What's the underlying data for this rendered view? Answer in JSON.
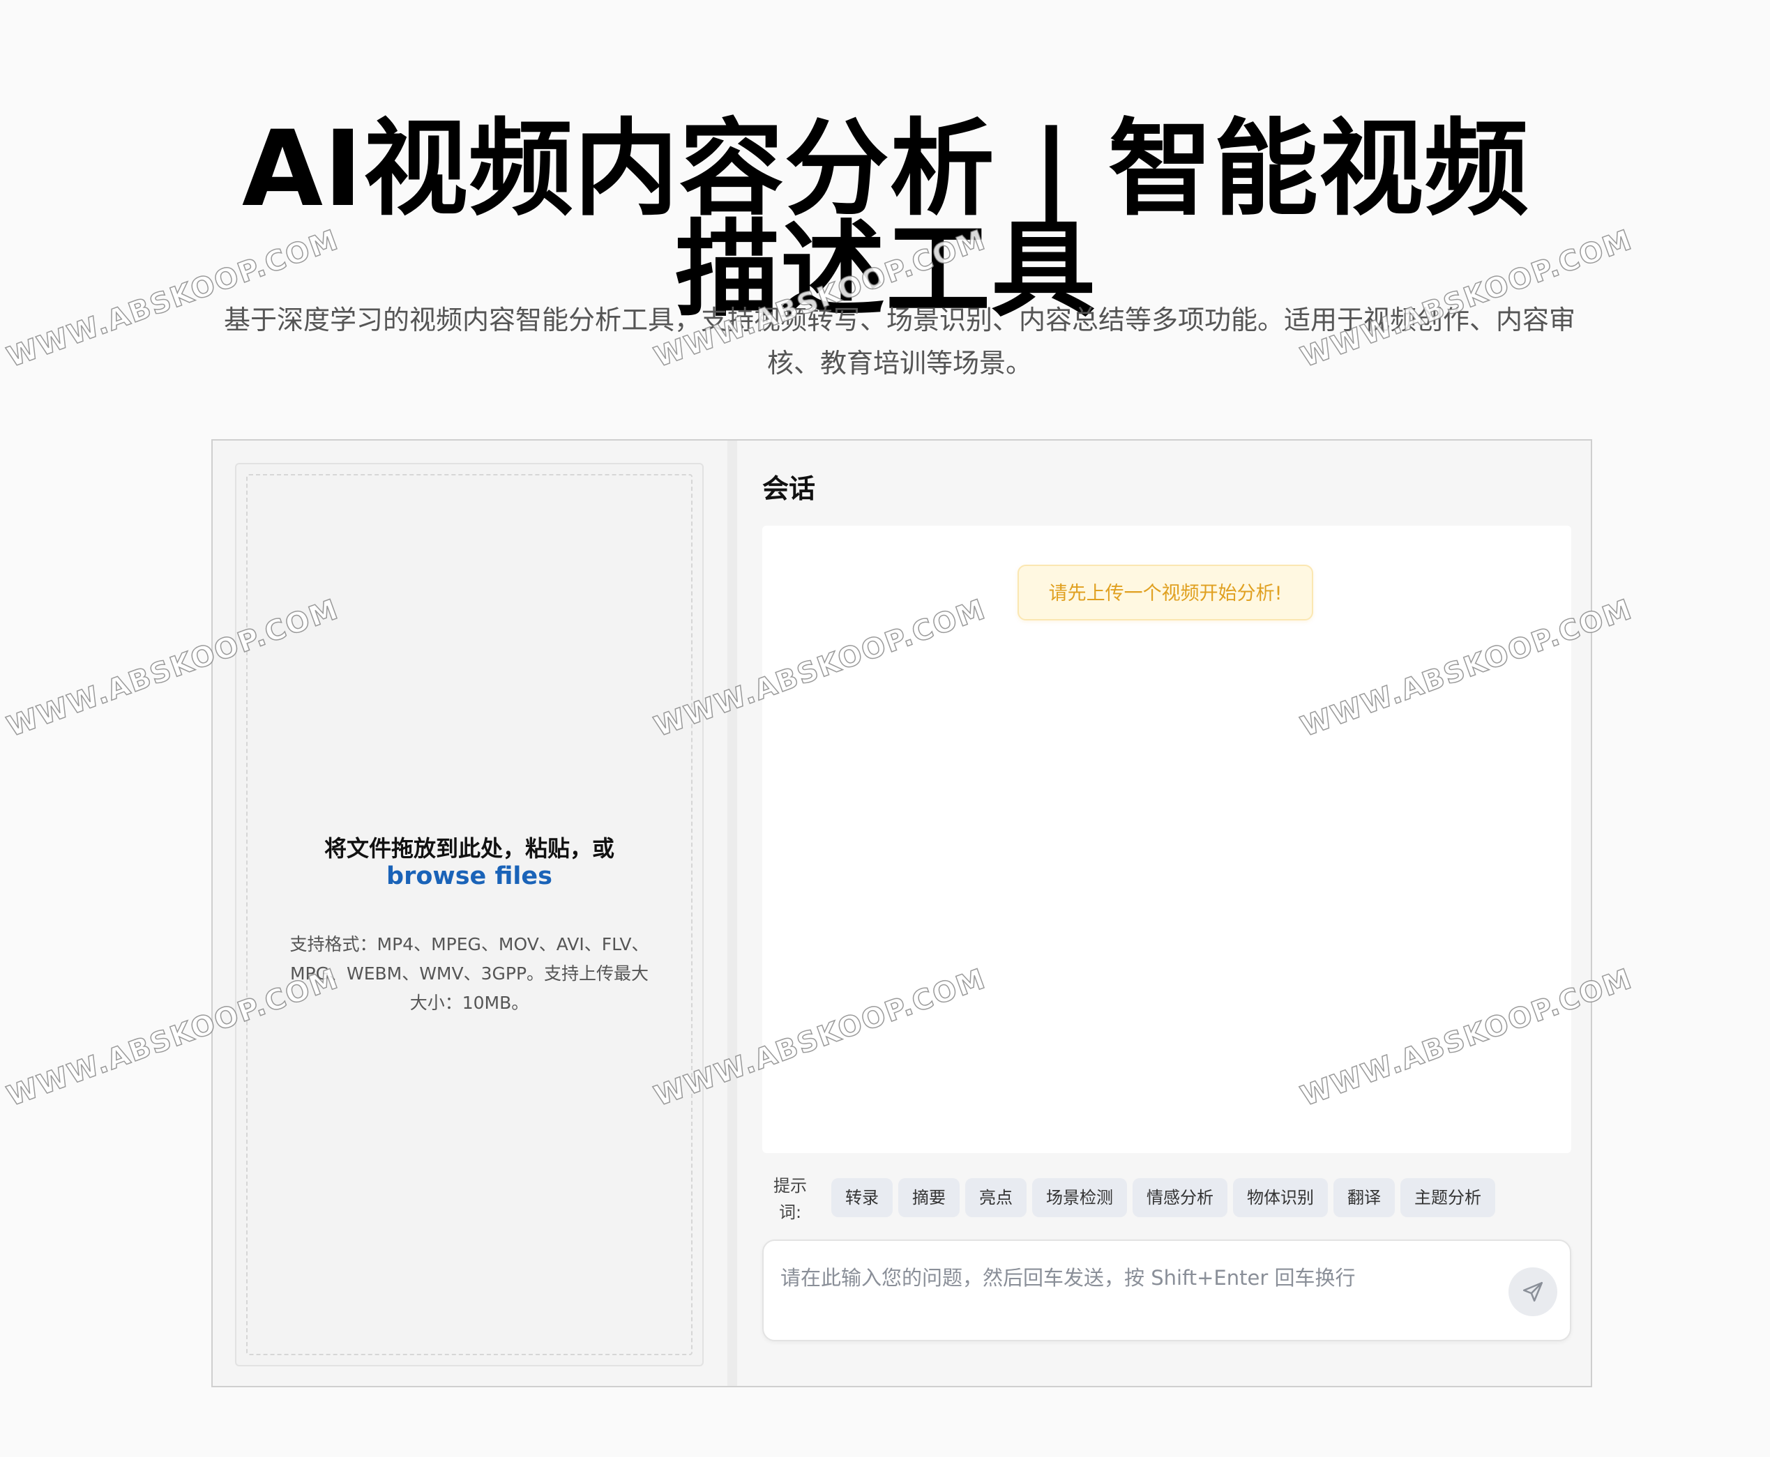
{
  "header": {
    "title": "AI视频内容分析 | 智能视频描述工具",
    "subtitle": "基于深度学习的视频内容智能分析工具，支持视频转写、场景识别、内容总结等多项功能。适用于视频创作、内容审核、教育培训等场景。"
  },
  "upload": {
    "drop_text": "将文件拖放到此处，粘贴，或",
    "browse_label": "browse files",
    "formats_text": "支持格式：MP4、MPEG、MOV、AVI、FLV、MPG、WEBM、WMV、3GPP。支持上传最大大小：10MB。"
  },
  "chat": {
    "title": "会话",
    "notice": "请先上传一个视频开始分析!",
    "prompts_label": "提示词:",
    "prompts": [
      "转录",
      "摘要",
      "亮点",
      "场景检测",
      "情感分析",
      "物体识别",
      "翻译",
      "主题分析"
    ],
    "input_placeholder": "请在此输入您的问题，然后回车发送，按 Shift+Enter 回车换行",
    "send_icon": "send-icon"
  },
  "watermark": {
    "text": "WWW.ABSKOOP.COM"
  },
  "colors": {
    "accent_link": "#1a63b8",
    "notice_text": "#e0a020",
    "notice_bg": "#fff8e1",
    "chip_bg": "#e8ebf1"
  }
}
